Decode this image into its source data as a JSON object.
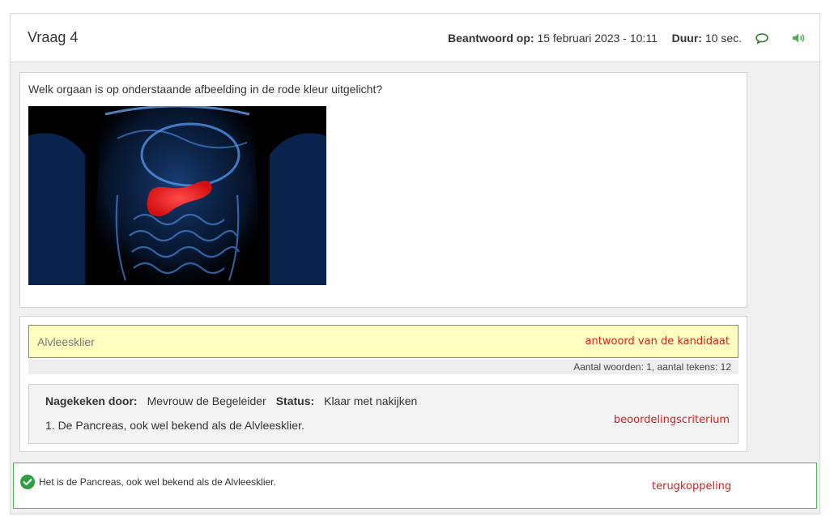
{
  "header": {
    "title": "Vraag 4",
    "answered_label": "Beantwoord op:",
    "answered_value": "15 februari 2023 - 10:11",
    "duration_label": "Duur:",
    "duration_value": "10 sec.",
    "icons": [
      "comment-icon",
      "speaker-icon"
    ]
  },
  "question": {
    "text": "Welk orgaan is op onderstaande afbeelding in de rode kleur uitgelicht?",
    "image_highlight_color": "#ff2a2a"
  },
  "answer": {
    "value": "Alvleesklier",
    "annotation": "antwoord van de kandidaat",
    "counter": "Aantal woorden: 1, aantal tekens: 12"
  },
  "grading": {
    "graded_by_label": "Nagekeken door:",
    "graded_by_value": "Mevrouw de Begeleider",
    "status_label": "Status:",
    "status_value": "Klaar met nakijken",
    "criterion": "1. De Pancreas, ook wel bekend als de Alvleesklier.",
    "annotation": "beoordelingscriterium"
  },
  "feedback": {
    "text": "Het is de Pancreas, ook wel bekend als de Alvleesklier.",
    "annotation": "terugkoppeling",
    "icon": "check-circle-icon"
  },
  "colors": {
    "accent_green": "#4caf50",
    "answer_bg": "#ffffc0",
    "annotation_red": "#d62020"
  }
}
